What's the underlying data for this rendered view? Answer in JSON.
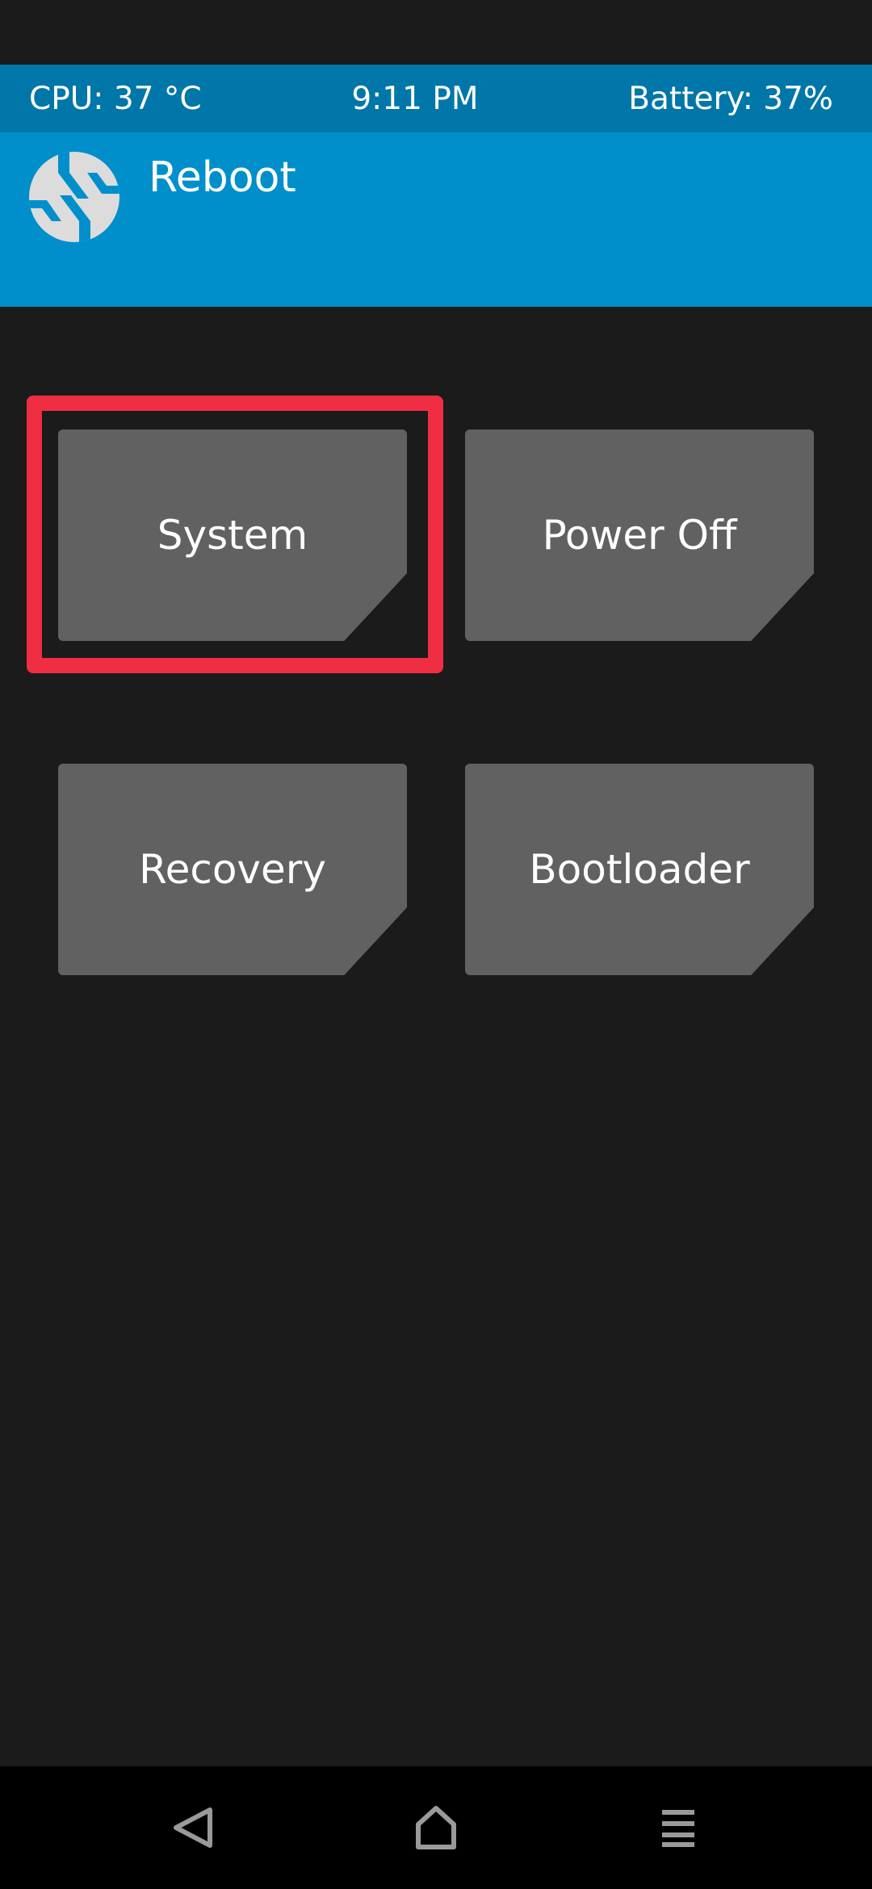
{
  "status_bar": {
    "cpu": "CPU: 37 °C",
    "time": "9:11 PM",
    "battery": "Battery: 37%"
  },
  "header": {
    "title": "Reboot",
    "logo_icon": "twrp-logo-icon"
  },
  "buttons": {
    "system": "System",
    "power_off": "Power Off",
    "recovery": "Recovery",
    "bootloader": "Bootloader"
  },
  "highlighted_button": "system",
  "nav_bar": {
    "back_icon": "back-triangle-icon",
    "home_icon": "home-icon",
    "menu_icon": "menu-lines-icon"
  },
  "colors": {
    "status_bar": "#0176a8",
    "header": "#018fcb",
    "background": "#1b1b1b",
    "tile": "#616161",
    "highlight": "#ef2d43"
  }
}
